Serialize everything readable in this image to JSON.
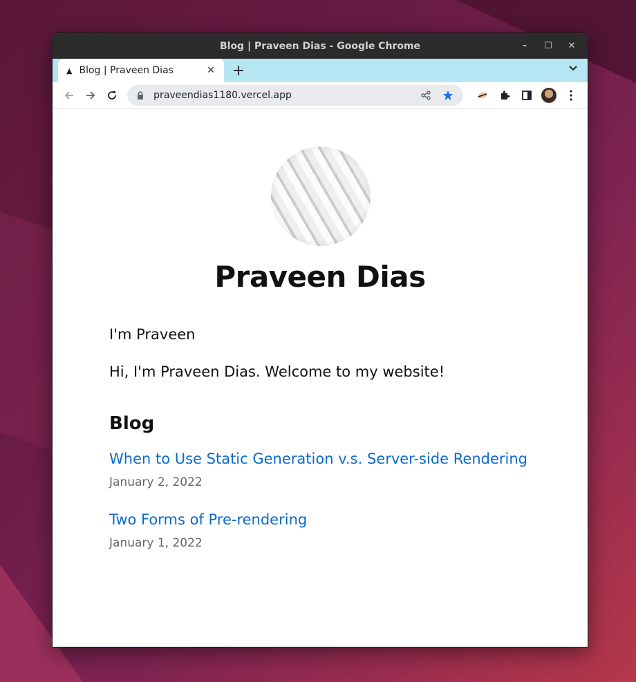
{
  "window": {
    "title": "Blog | Praveen Dias - Google Chrome",
    "controls": {
      "minimize": "–",
      "maximize": "☐",
      "close": "✕"
    }
  },
  "tabs": [
    {
      "label": "Blog | Praveen Dias",
      "favicon": "triangle-icon",
      "close": "✕"
    }
  ],
  "tabstrip": {
    "new_tab": "+",
    "tab_menu": "⌄"
  },
  "toolbar": {
    "url": "praveendias1180.vercel.app",
    "icons": [
      "back-icon",
      "forward-icon",
      "reload-icon",
      "lock-icon",
      "share-icon",
      "bookmark-star-icon",
      "extension-icon",
      "puzzle-icon",
      "side-panel-icon",
      "profile-avatar",
      "kebab-menu-icon"
    ]
  },
  "page": {
    "name": "Praveen Dias",
    "intro": "I'm Praveen",
    "welcome": "Hi, I'm Praveen Dias. Welcome to my website!",
    "blog_heading": "Blog",
    "posts": [
      {
        "title": "When to Use Static Generation v.s. Server-side Rendering",
        "date": "January 2, 2022"
      },
      {
        "title": "Two Forms of Pre-rendering",
        "date": "January 1, 2022"
      }
    ]
  },
  "colors": {
    "link": "#0b6bcb",
    "tabstrip": "#b6e6f3",
    "titlebar": "#2b2b2b",
    "star": "#1a73e8"
  }
}
